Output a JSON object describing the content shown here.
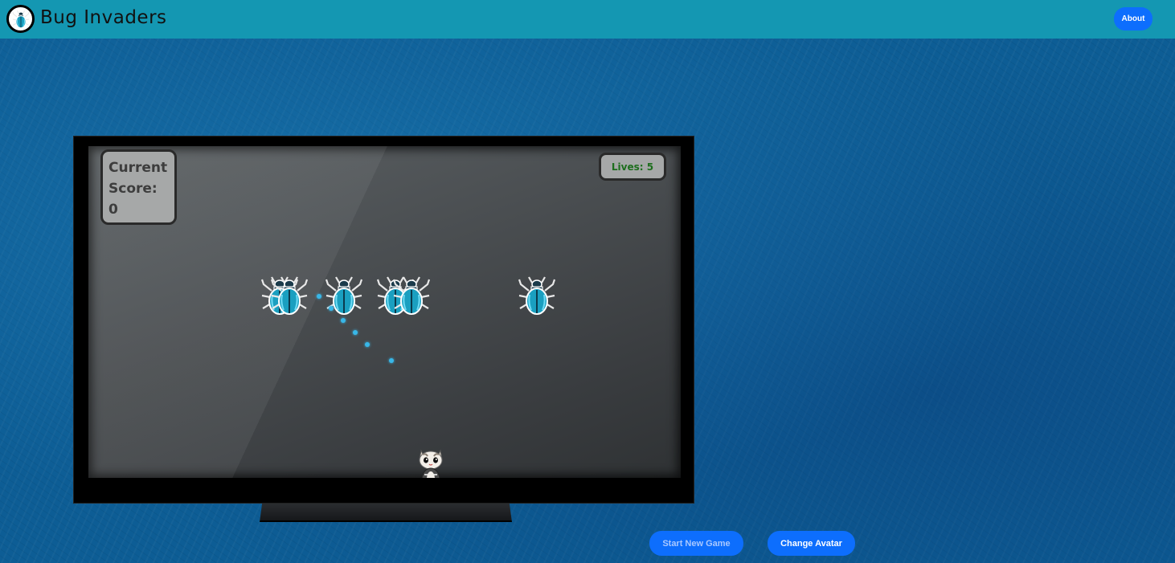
{
  "navbar": {
    "brand": "Bug Invaders",
    "logo_icon": "beetle-icon",
    "about_label": "About"
  },
  "game": {
    "score_label_1": "Current",
    "score_label_2": "Score:",
    "score_value": "0",
    "lives_text": "Lives: 5",
    "bug_icon": "beetle-icon",
    "avatar_icon": "cat-avatar-icon",
    "enemy_count": 6,
    "bullet_count": 6
  },
  "controls": {
    "start_label": "Start New Game",
    "change_avatar_label": "Change Avatar"
  },
  "colors": {
    "navbar": "#1497b2",
    "button": "#0d6efd",
    "beetle_shell": "#1a9fc0",
    "bullet": "#38b7e8",
    "lives_text": "#1d6e1d"
  }
}
